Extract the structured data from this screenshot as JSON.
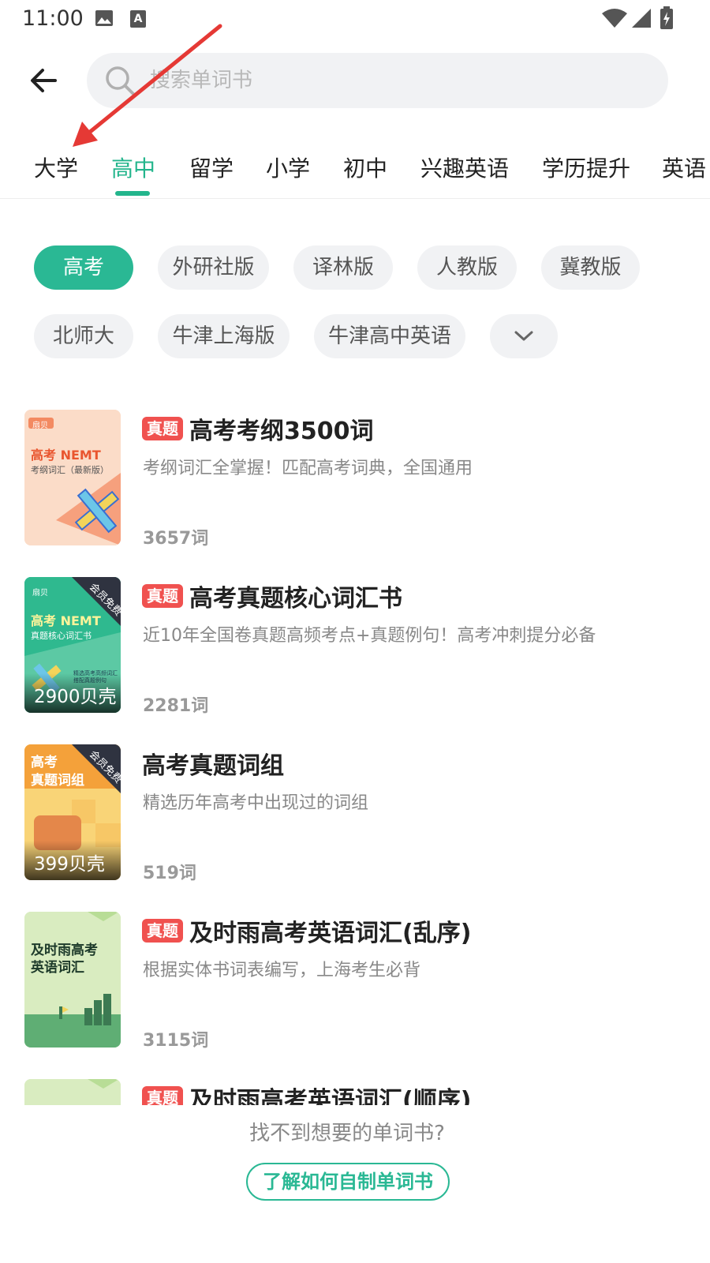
{
  "status_bar": {
    "time": "11:00"
  },
  "search": {
    "placeholder": "搜索单词书"
  },
  "tabs": [
    {
      "label": "大学"
    },
    {
      "label": "高中",
      "active": true
    },
    {
      "label": "留学"
    },
    {
      "label": "小学"
    },
    {
      "label": "初中"
    },
    {
      "label": "兴趣英语"
    },
    {
      "label": "学历提升"
    },
    {
      "label": "英语"
    }
  ],
  "filters": [
    {
      "label": "高考",
      "active": true
    },
    {
      "label": "外研社版"
    },
    {
      "label": "译林版"
    },
    {
      "label": "人教版"
    },
    {
      "label": "冀教版"
    },
    {
      "label": "北师大"
    },
    {
      "label": "牛津上海版"
    },
    {
      "label": "牛津高中英语"
    }
  ],
  "tag_label": "真题",
  "books": [
    {
      "title": "高考考纲3500词",
      "tag": true,
      "desc": "考纲词汇全掌握！匹配高考词典，全国通用",
      "count": "3657词",
      "cover": {
        "brand": "扇贝",
        "line1": "高考 NEMT",
        "line2": "考纲词汇（最新版）",
        "bg": "#fbdcc8"
      }
    },
    {
      "title": "高考真题核心词汇书",
      "tag": true,
      "desc": "近10年全国卷真题高频考点+真题例句！高考冲刺提分必备",
      "count": "2281词",
      "price": "2900贝壳",
      "cover": {
        "brand": "扇贝",
        "line1": "高考 NEMT",
        "line2": "真题核心词汇书",
        "ribbon": "会员免费",
        "small": "精选高考高频词汇 搭配真题例句",
        "bg": "#2fb98f"
      }
    },
    {
      "title": "高考真题词组",
      "tag": false,
      "desc": "精选历年高考中出现过的词组",
      "count": "519词",
      "price": "399贝壳",
      "cover": {
        "line1": "高考",
        "line2": "真题词组",
        "ribbon": "会员免费",
        "bg": "#f9d477"
      }
    },
    {
      "title": "及时雨高考英语词汇(乱序)",
      "tag": true,
      "desc": "根据实体书词表编写，上海考生必背",
      "count": "3115词",
      "cover": {
        "line1": "及时雨高考",
        "line2": "英语词汇",
        "bg": "#d9ecc0"
      }
    },
    {
      "title": "及时雨高考英语词汇(顺序)",
      "tag": true,
      "cover": {
        "bg": "#d9ecc0"
      }
    }
  ],
  "footer": {
    "hint": "找不到想要的单词书?",
    "button": "了解如何自制单词书"
  },
  "colors": {
    "accent": "#23b58c",
    "tag": "#f0514f",
    "annotation_arrow": "#e53935"
  }
}
